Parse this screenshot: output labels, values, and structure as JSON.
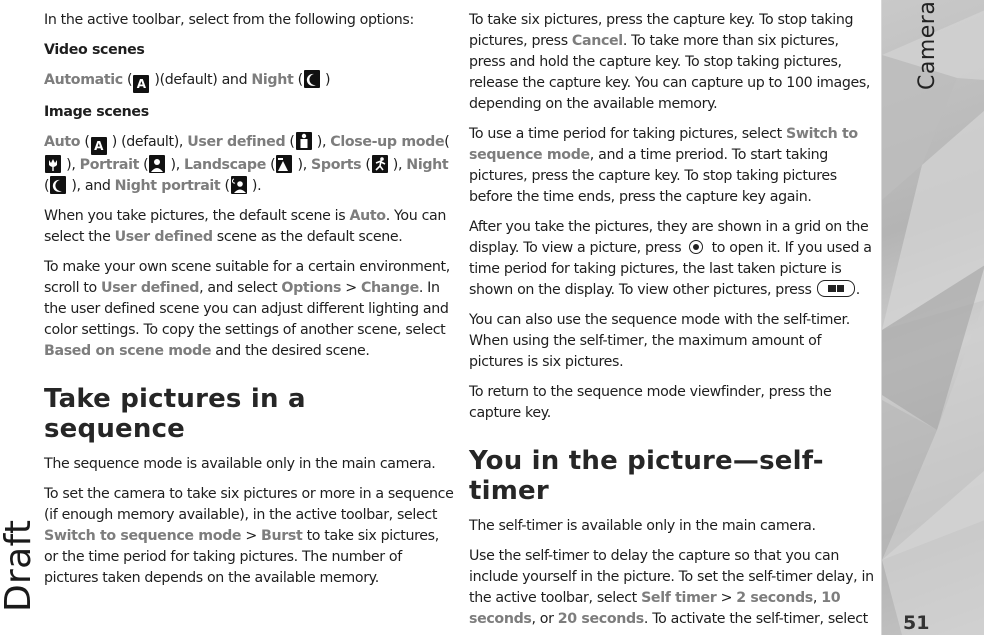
{
  "page": {
    "chapter": "Camera",
    "page_number": "51",
    "watermark": "Draft"
  },
  "left": {
    "intro": "In the active toolbar, select from the following options:",
    "video_heading": "Video scenes",
    "video": {
      "automatic": "Automatic",
      "t1": " (",
      "t2": " )(default) and ",
      "night": "Night",
      "t3": " (",
      "t4": " )"
    },
    "image_heading": "Image scenes",
    "image": {
      "auto": "Auto",
      "t1": " (",
      "t2": " ) (default), ",
      "user_defined": "User defined",
      "t3": " (",
      "t4": " ), ",
      "closeup": "Close-up mode",
      "t5": "(",
      "t6": " ), ",
      "portrait": "Portrait",
      "t7": " (",
      "t8": " ), ",
      "landscape": "Landscape",
      "t9": " (",
      "t10": " ), ",
      "sports": "Sports",
      "t11": " (",
      "t12": " ), ",
      "night": "Night",
      "t13": " (",
      "t14": " ), and ",
      "night_portrait": "Night portrait",
      "t15": " (",
      "t16": " )."
    },
    "default_para": {
      "t1": "When you take pictures, the default scene is ",
      "auto": "Auto",
      "t2": ". You can select the ",
      "user_defined": "User defined",
      "t3": " scene as the default scene."
    },
    "own_scene_para": {
      "t1": "To make your own scene suitable for a certain environment, scroll to ",
      "user_defined": "User defined",
      "t2": ", and select ",
      "options": "Options",
      "t3": " > ",
      "change": "Change",
      "t4": ". In the user defined scene you can adjust different lighting and color settings. To copy the settings of another scene, select ",
      "based": "Based on scene mode",
      "t5": " and the desired scene."
    },
    "sequence_heading": "Take pictures in a sequence",
    "seq_avail": "The sequence mode is available only in the main camera.",
    "seq_para": {
      "t1": "To set the camera to take six pictures or more in a sequence (if enough memory available), in the active toolbar, select ",
      "switch": "Switch to sequence mode",
      "t2": " > ",
      "burst": "Burst",
      "t3": " to take six pictures, or the time period for taking pictures. The number of pictures taken depends on the available memory."
    }
  },
  "right": {
    "p1": {
      "t1": "To take six pictures, press the capture key. To stop taking pictures, press ",
      "cancel": "Cancel",
      "t2": ". To take more than six pictures, press and hold the capture key. To stop taking pictures, release the capture key. You can capture up to 100 images, depending on the available memory."
    },
    "p2": {
      "t1": "To use a time period for taking pictures, select ",
      "switch": "Switch to sequence mode",
      "t2": ", and a time preriod. To start taking pictures, press the capture key. To stop taking pictures before the time ends, press the capture key again."
    },
    "p3": {
      "t1": "After you take the pictures, they are shown in a grid on the display. To view a picture, press ",
      "t2": " to open it. If you used a time period for taking pictures, the last taken picture is shown on the display. To view other pictures, press ",
      "t3": "."
    },
    "p4": "You can also use the sequence mode with the self-timer. When using the self-timer, the maximum amount of pictures is six pictures.",
    "p5": "To return to the sequence mode viewfinder, press the capture key.",
    "selftimer_heading": "You in the picture—self-timer",
    "p6": "The self-timer is available only in the main camera.",
    "p7": {
      "t1": "Use the self-timer to delay the capture so that you can include yourself in the picture. To set the self-timer delay, in the active toolbar, select ",
      "self_timer": "Self timer",
      "t2": " > ",
      "s2": "2 seconds",
      "t3": ", ",
      "s10": "10 seconds",
      "t4": ", or ",
      "s20": "20 seconds",
      "t5": ". To activate the self-timer, select"
    }
  },
  "icons": {
    "auto_letter": "A"
  }
}
